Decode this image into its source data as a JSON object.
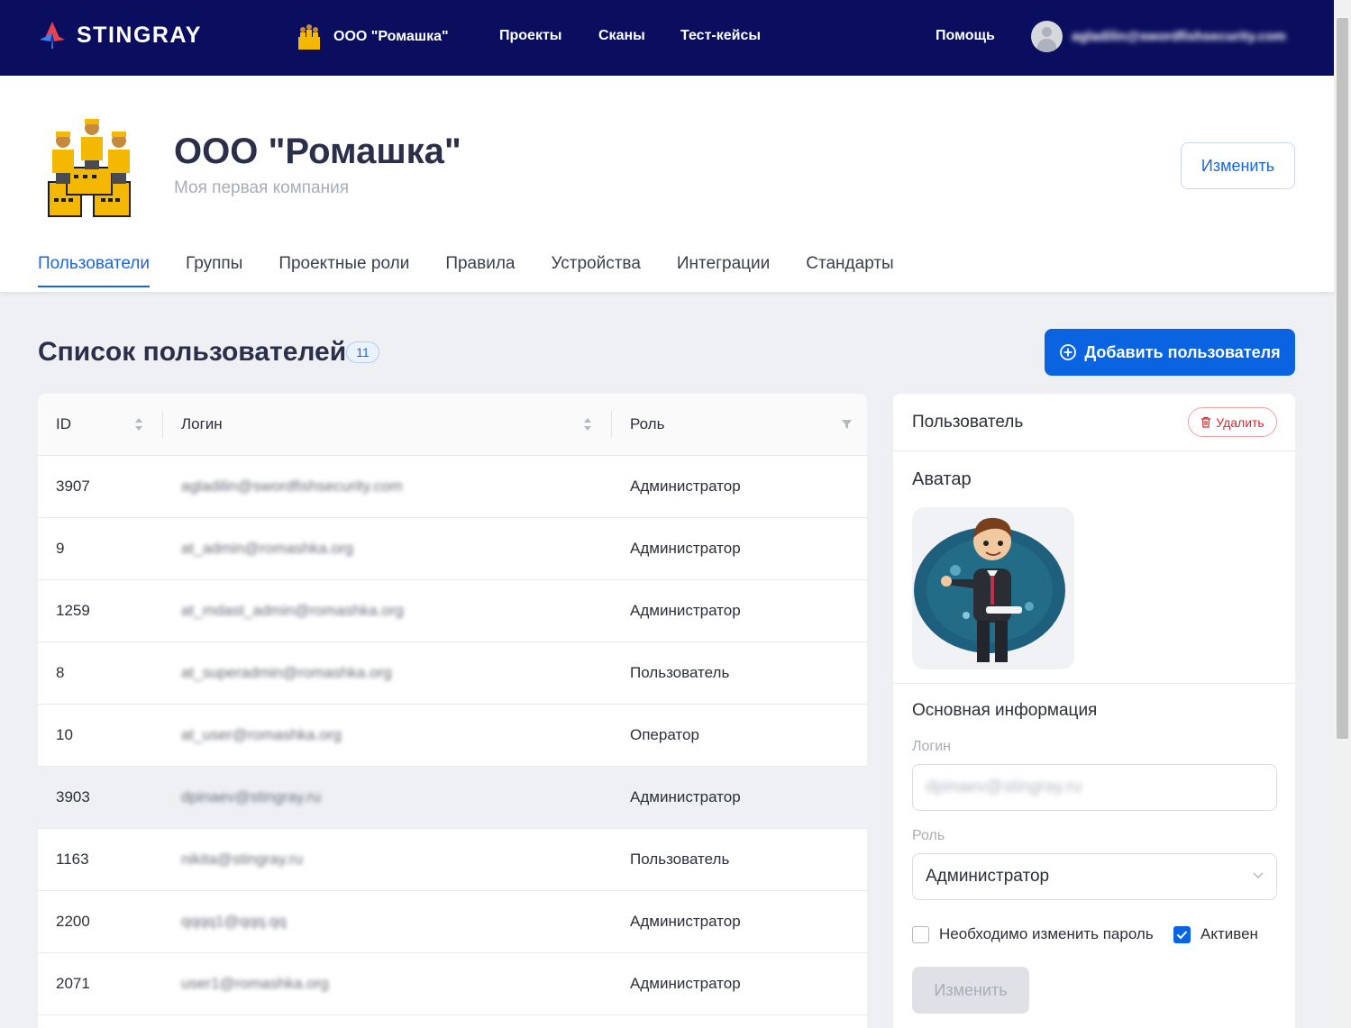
{
  "nav": {
    "brand": "STINGRAY",
    "org": "ООО \"Ромашка\"",
    "links": [
      "Проекты",
      "Сканы",
      "Тест-кейсы"
    ],
    "help": "Помощь",
    "user_email": "agladilin@swordfishsecurity.com"
  },
  "header": {
    "title": "ООО \"Ромашка\"",
    "subtitle": "Моя первая компания",
    "edit_label": "Изменить",
    "tabs": [
      "Пользователи",
      "Группы",
      "Проектные роли",
      "Правила",
      "Устройства",
      "Интеграции",
      "Стандарты"
    ],
    "active_tab": "Пользователи"
  },
  "main": {
    "title": "Список пользователей",
    "count": "11",
    "add_label": "Добавить пользователя"
  },
  "table": {
    "columns": [
      "ID",
      "Логин",
      "Роль"
    ],
    "rows": [
      {
        "id": "3907",
        "login": "agladilin@swordfishsecurity.com",
        "role": "Администратор"
      },
      {
        "id": "9",
        "login": "at_admin@romashka.org",
        "role": "Администратор"
      },
      {
        "id": "1259",
        "login": "at_mdast_admin@romashka.org",
        "role": "Администратор"
      },
      {
        "id": "8",
        "login": "at_superadmin@romashka.org",
        "role": "Пользователь"
      },
      {
        "id": "10",
        "login": "at_user@romashka.org",
        "role": "Оператор"
      },
      {
        "id": "3903",
        "login": "dpinaev@stingray.ru",
        "role": "Администратор"
      },
      {
        "id": "1163",
        "login": "nikita@stingray.ru",
        "role": "Пользователь"
      },
      {
        "id": "2200",
        "login": "qqqq1@qqq.qq",
        "role": "Администратор"
      },
      {
        "id": "2071",
        "login": "user1@romashka.org",
        "role": "Администратор"
      }
    ],
    "selected_row": 5
  },
  "panel": {
    "title": "Пользователь",
    "delete_label": "Удалить",
    "avatar_label": "Аватар",
    "info_title": "Основная информация",
    "login_label": "Логин",
    "login_value": "dpinaev@stingray.ru",
    "role_label": "Роль",
    "role_value": "Администратор",
    "change_password_label": "Необходимо изменить пароль",
    "change_password_checked": false,
    "active_label": "Активен",
    "active_checked": true,
    "save_label": "Изменить"
  },
  "colors": {
    "nav_bg": "#0b0e5e",
    "accent": "#0a64e2",
    "danger": "#d7262f",
    "selected_row": "#eef0f4"
  }
}
